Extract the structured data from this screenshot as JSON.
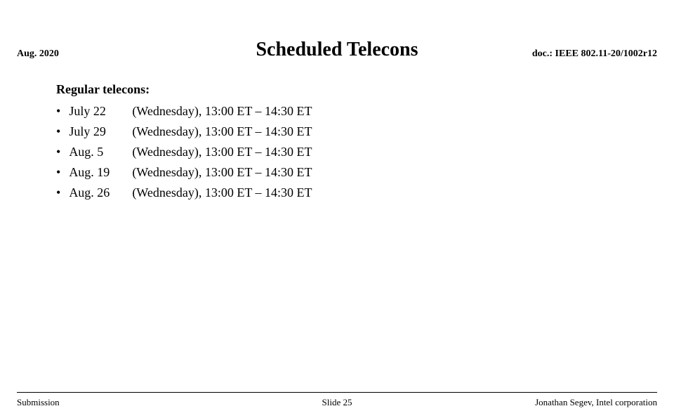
{
  "header": {
    "left": "Aug. 2020",
    "right": "doc.: IEEE 802.11-20/1002r12"
  },
  "title": "Scheduled Telecons",
  "regular_label": "Regular telecons:",
  "telecons": [
    {
      "date": "July 22",
      "description": "(Wednesday), 13:00 ET – 14:30 ET"
    },
    {
      "date": "July 29",
      "description": "(Wednesday), 13:00 ET – 14:30 ET"
    },
    {
      "date": "Aug. 5",
      "description": "(Wednesday), 13:00 ET – 14:30 ET"
    },
    {
      "date": "Aug. 19",
      "description": "(Wednesday), 13:00 ET – 14:30 ET"
    },
    {
      "date": "Aug. 26",
      "description": "(Wednesday), 13:00 ET – 14:30 ET"
    }
  ],
  "footer": {
    "left": "Submission",
    "center": "Slide 25",
    "right": "Jonathan Segev, Intel corporation"
  }
}
